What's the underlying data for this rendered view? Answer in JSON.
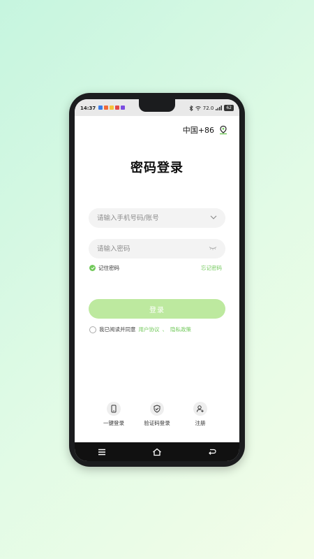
{
  "status_bar": {
    "time": "14:37",
    "app_icon_colors": [
      "#3b7de8",
      "#f06b3a",
      "#f5c33b",
      "#e04848",
      "#7c4de0"
    ],
    "network_speed": "72.0",
    "battery": "62"
  },
  "header": {
    "region_code": "中国+86",
    "region_icon": "location-pin-icon"
  },
  "page_title": "密码登录",
  "form": {
    "account_placeholder": "请输入手机号码/账号",
    "account_value": "",
    "password_placeholder": "请输入密码",
    "password_value": "",
    "remember_label": "记住密码",
    "remember_checked": true,
    "forgot_label": "忘记密码"
  },
  "login_button": "登录",
  "agreement": {
    "prefix": "我已阅读并同意",
    "user_agreement": "用户协议",
    "separator": "、",
    "privacy_policy": "隐私政策"
  },
  "alt_logins": [
    {
      "label": "一键登录",
      "icon": "phone-icon"
    },
    {
      "label": "验证码登录",
      "icon": "shield-check-icon"
    },
    {
      "label": "注册",
      "icon": "add-user-icon"
    }
  ],
  "colors": {
    "accent": "#72c95b",
    "button": "#bde99f",
    "field_bg": "#f3f3f3"
  }
}
